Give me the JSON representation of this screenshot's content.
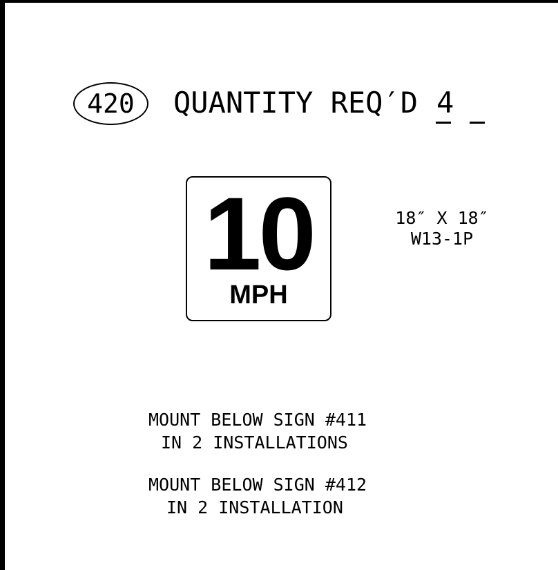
{
  "sheet": {
    "sign_number": "420",
    "quantity_label": "QUANTITY REQ′D",
    "quantity_value": "4"
  },
  "sign": {
    "speed_value": "10",
    "speed_unit": "MPH",
    "size": "18″ X 18″",
    "code": "W13-1P"
  },
  "notes": [
    {
      "line1": "MOUNT BELOW SIGN #411",
      "line2": "IN 2 INSTALLATIONS"
    },
    {
      "line1": "MOUNT BELOW SIGN #412",
      "line2": "IN 2 INSTALLATION"
    }
  ]
}
